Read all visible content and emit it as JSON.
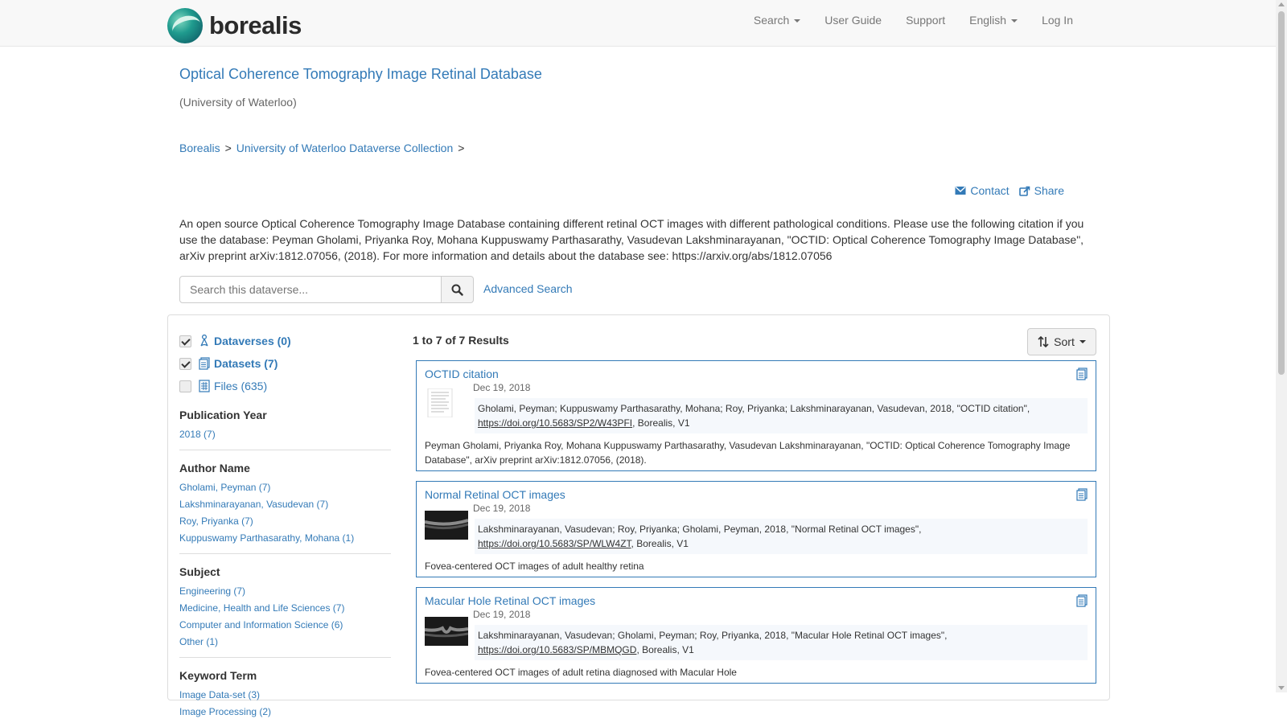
{
  "nav": {
    "brand": "borealis",
    "search": "Search",
    "user_guide": "User Guide",
    "support": "Support",
    "language": "English",
    "login": "Log In"
  },
  "dataverse": {
    "title": "Optical Coherence Tomography Image Retinal Database",
    "affiliation": "(University of Waterloo)",
    "breadcrumbs": [
      "Borealis",
      "University of Waterloo Dataverse Collection"
    ],
    "contact": "Contact",
    "share": "Share",
    "description": "An open source Optical Coherence Tomography Image Database containing different retinal OCT images with different pathological conditions. Please use the following citation if you use the database: Peyman Gholami, Priyanka Roy, Mohana Kuppuswamy Parthasarathy, Vasudevan Lakshminarayanan, \"OCTID: Optical Coherence Tomography Image Database\", arXiv preprint arXiv:1812.07056, (2018). For more information and details about the database see: https://arxiv.org/abs/1812.07056"
  },
  "search": {
    "placeholder": "Search this dataverse...",
    "advanced": "Advanced Search"
  },
  "types": [
    {
      "label": "Dataverses (0)",
      "checked": true
    },
    {
      "label": "Datasets (7)",
      "checked": true
    },
    {
      "label": "Files (635)",
      "checked": false
    }
  ],
  "facets": {
    "year": {
      "title": "Publication Year",
      "items": [
        "2018 (7)"
      ]
    },
    "author": {
      "title": "Author Name",
      "items": [
        "Gholami, Peyman (7)",
        "Lakshminarayanan, Vasudevan (7)",
        "Roy, Priyanka (7)",
        "Kuppuswamy Parthasarathy, Mohana (1)"
      ]
    },
    "subject": {
      "title": "Subject",
      "items": [
        "Engineering (7)",
        "Medicine, Health and Life Sciences (7)",
        "Computer and Information Science (6)",
        "Other (1)"
      ]
    },
    "keyword": {
      "title": "Keyword Term",
      "items": [
        "Image Data-set (3)",
        "Image Processing (2)"
      ]
    }
  },
  "results": {
    "count": "1 to 7 of 7 Results",
    "sort": "Sort",
    "items": [
      {
        "title": "OCTID citation",
        "date": "Dec 19, 2018",
        "citation": "Gholami, Peyman; Kuppuswamy Parthasarathy, Mohana; Roy, Priyanka; Lakshminarayanan, Vasudevan, 2018, \"OCTID citation\",",
        "doi": "https://doi.org/10.5683/SP2/W43PFI",
        "publisher": ", Borealis, V1",
        "description": "Peyman Gholami, Priyanka Roy, Mohana Kuppuswamy Parthasarathy, Vasudevan Lakshminarayanan, \"OCTID: Optical Coherence Tomography Image Database\", arXiv preprint arXiv:1812.07056, (2018)."
      },
      {
        "title": "Normal Retinal OCT images",
        "date": "Dec 19, 2018",
        "citation": "Lakshminarayanan, Vasudevan; Roy, Priyanka; Gholami, Peyman, 2018, \"Normal Retinal OCT images\",",
        "doi": "https://doi.org/10.5683/SP/WLW4ZT",
        "publisher": ", Borealis, V1",
        "description": "Fovea-centered OCT images of adult healthy retina"
      },
      {
        "title": "Macular Hole Retinal OCT images",
        "date": "Dec 19, 2018",
        "citation": "Lakshminarayanan, Vasudevan; Gholami, Peyman; Roy, Priyanka, 2018, \"Macular Hole Retinal OCT images\",",
        "doi": "https://doi.org/10.5683/SP/MBMQGD",
        "publisher": ", Borealis, V1",
        "description": "Fovea-centered OCT images of adult retina diagnosed with Macular Hole"
      }
    ]
  }
}
